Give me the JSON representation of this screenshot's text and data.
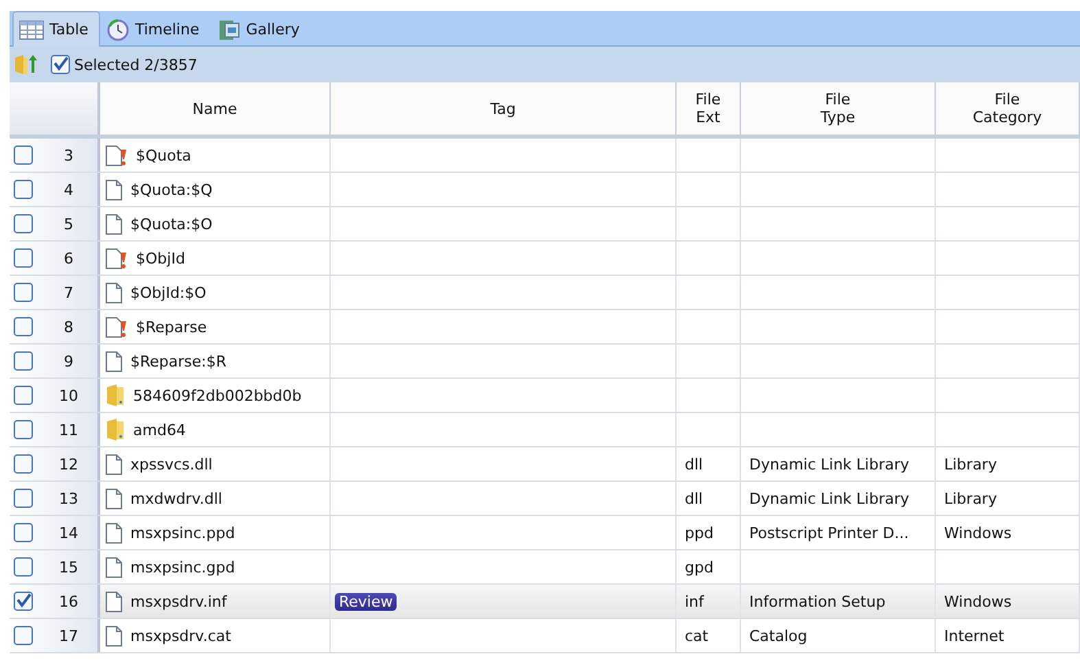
{
  "tabs": [
    {
      "label": "Table",
      "selected": true
    },
    {
      "label": "Timeline",
      "selected": false
    },
    {
      "label": "Gallery",
      "selected": false
    }
  ],
  "toolbar": {
    "selected_count": "Selected 2/3857",
    "all_checked": true
  },
  "table": {
    "columns": [
      "",
      "Name",
      "Tag",
      "File\nExt",
      "File\nType",
      "File\nCategory"
    ],
    "rows": [
      {
        "number": "3",
        "kind": "flagged",
        "name": "$Quota",
        "checked": false,
        "selected": false
      },
      {
        "number": "4",
        "kind": "file",
        "name": "$Quota:$Q",
        "checked": false,
        "selected": false
      },
      {
        "number": "5",
        "kind": "file",
        "name": "$Quota:$O",
        "checked": false,
        "selected": false
      },
      {
        "number": "6",
        "kind": "flagged",
        "name": "$ObjId",
        "checked": false,
        "selected": false
      },
      {
        "number": "7",
        "kind": "file",
        "name": "$ObjId:$O",
        "checked": false,
        "selected": false
      },
      {
        "number": "8",
        "kind": "flagged",
        "name": "$Reparse",
        "checked": false,
        "selected": false
      },
      {
        "number": "9",
        "kind": "file",
        "name": "$Reparse:$R",
        "checked": false,
        "selected": false
      },
      {
        "number": "10",
        "kind": "folder",
        "name": "584609f2db002bbd0b",
        "checked": false,
        "selected": false
      },
      {
        "number": "11",
        "kind": "folder",
        "name": "amd64",
        "checked": false,
        "selected": false
      },
      {
        "number": "12",
        "kind": "file",
        "name": "xpssvcs.dll",
        "ext": "dll",
        "type": "Dynamic Link Library",
        "category": "Library",
        "checked": false,
        "selected": false
      },
      {
        "number": "13",
        "kind": "file",
        "name": "mxdwdrv.dll",
        "ext": "dll",
        "type": "Dynamic Link Library",
        "category": "Library",
        "checked": false,
        "selected": false
      },
      {
        "number": "14",
        "kind": "file",
        "name": "msxpsinc.ppd",
        "ext": "ppd",
        "type": "Postscript Printer D...",
        "category": "Windows",
        "checked": false,
        "selected": false
      },
      {
        "number": "15",
        "kind": "file",
        "name": "msxpsinc.gpd",
        "ext": "gpd",
        "checked": false,
        "selected": false
      },
      {
        "number": "16",
        "kind": "file",
        "name": "msxpsdrv.inf",
        "tag": "Review",
        "ext": "inf",
        "type": "Information Setup",
        "category": "Windows",
        "checked": true,
        "selected": true
      },
      {
        "number": "17",
        "kind": "file",
        "name": "msxpsdrv.cat",
        "ext": "cat",
        "type": "Catalog",
        "category": "Internet",
        "checked": false,
        "selected": false
      }
    ]
  }
}
